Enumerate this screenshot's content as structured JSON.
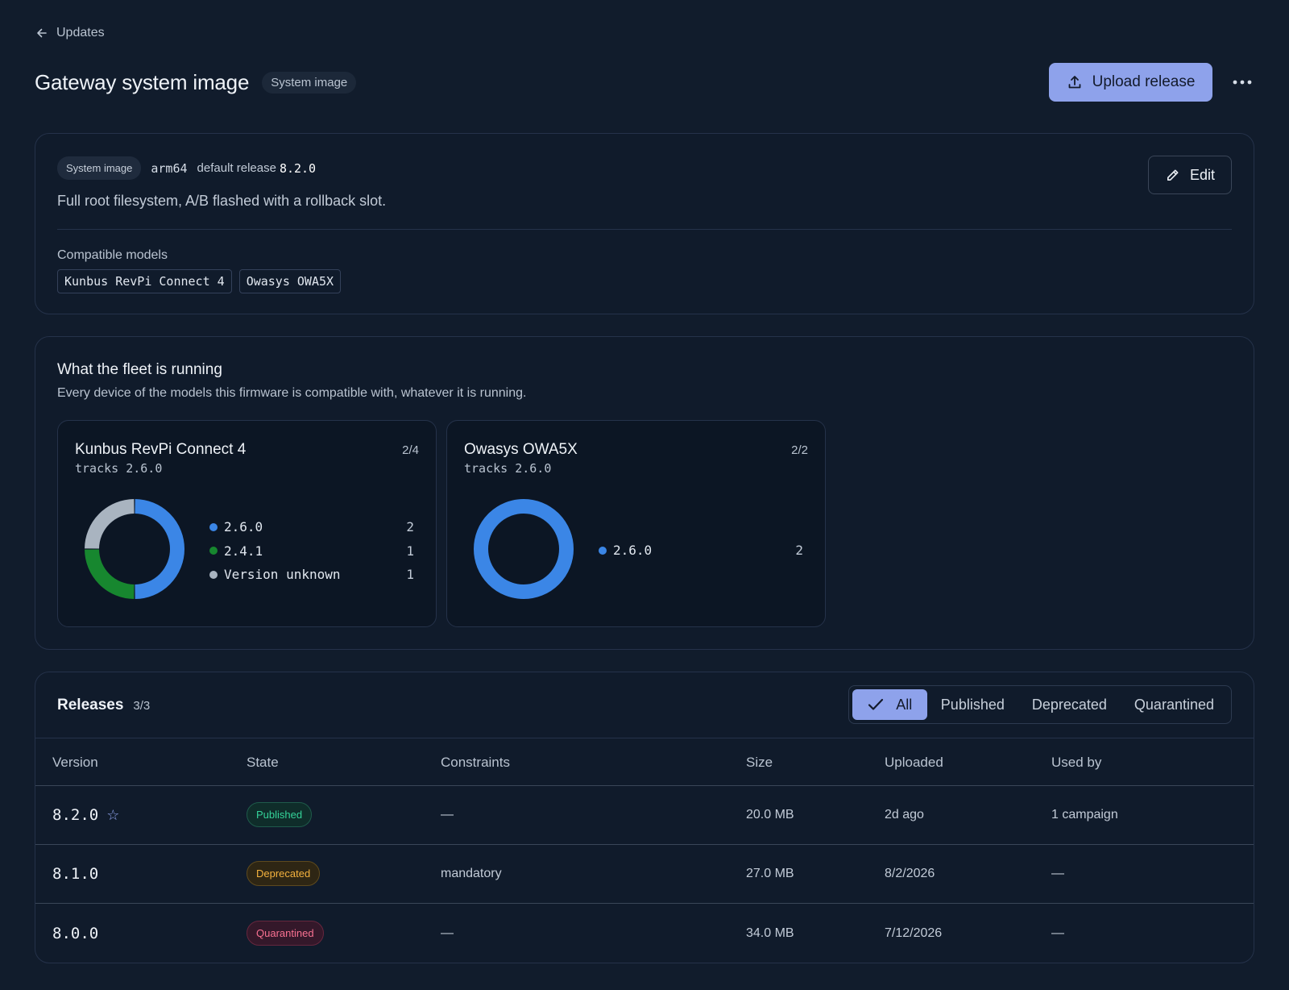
{
  "back": {
    "label": "Updates"
  },
  "header": {
    "title": "Gateway system image",
    "type_badge": "System image",
    "upload_label": "Upload release"
  },
  "info": {
    "type_badge": "System image",
    "arch": "arm64",
    "default_release_label": "default release",
    "default_release": "8.2.0",
    "description": "Full root filesystem, A/B flashed with a rollback slot.",
    "edit_label": "Edit",
    "models_label": "Compatible models",
    "models": [
      "Kunbus RevPi Connect 4",
      "Owasys OWA5X"
    ]
  },
  "fleet": {
    "title": "What the fleet is running",
    "subtitle": "Every device of the models this firmware is compatible with, whatever it is running.",
    "models": [
      {
        "name": "Kunbus RevPi Connect 4",
        "count": "2/4",
        "tracks": "tracks 2.6.0",
        "versions": [
          {
            "label": "2.6.0",
            "count": 2,
            "color": "#3b86e6"
          },
          {
            "label": "2.4.1",
            "count": 1,
            "color": "#17872f"
          },
          {
            "label": "Version unknown",
            "count": 1,
            "color": "#a9b4c0"
          }
        ]
      },
      {
        "name": "Owasys OWA5X",
        "count": "2/2",
        "tracks": "tracks 2.6.0",
        "versions": [
          {
            "label": "2.6.0",
            "count": 2,
            "color": "#3b86e6"
          }
        ]
      }
    ]
  },
  "releases": {
    "title": "Releases",
    "count": "3/3",
    "filters": [
      "All",
      "Published",
      "Deprecated",
      "Quarantined"
    ],
    "active_filter": "All",
    "columns": [
      "Version",
      "State",
      "Constraints",
      "Size",
      "Uploaded",
      "Used by"
    ],
    "rows": [
      {
        "version": "8.2.0",
        "default": true,
        "state": "Published",
        "constraints": "—",
        "size": "20.0 MB",
        "uploaded": "2d ago",
        "used_by": "1 campaign"
      },
      {
        "version": "8.1.0",
        "default": false,
        "state": "Deprecated",
        "constraints": "mandatory",
        "size": "27.0 MB",
        "uploaded": "8/2/2026",
        "used_by": "—"
      },
      {
        "version": "8.0.0",
        "default": false,
        "state": "Quarantined",
        "constraints": "—",
        "size": "34.0 MB",
        "uploaded": "7/12/2026",
        "used_by": "—"
      }
    ]
  }
}
